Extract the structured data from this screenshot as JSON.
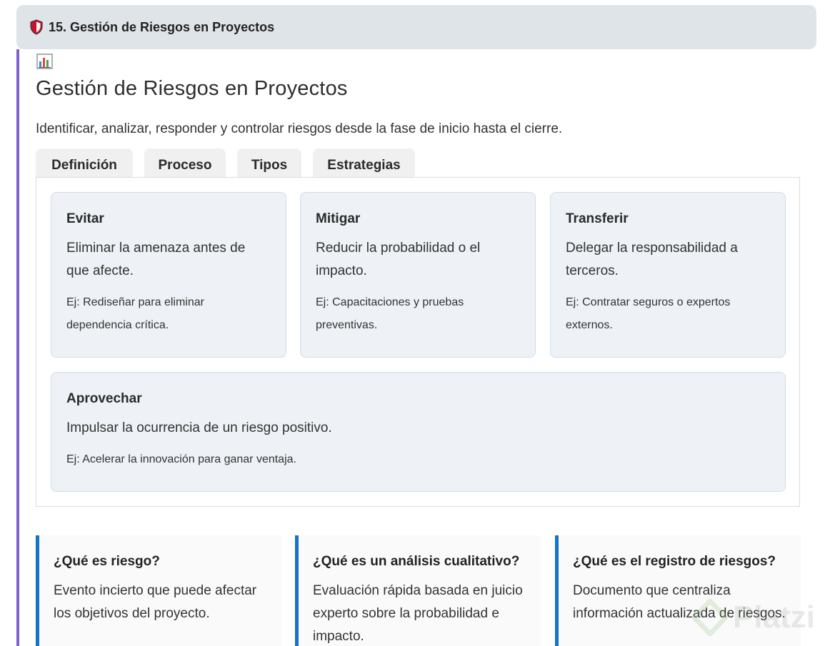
{
  "section": {
    "icon": "shield-icon",
    "title": "15. Gestión de Riesgos en Proyectos"
  },
  "content": {
    "icon": "bar-chart-icon",
    "title": "Gestión de Riesgos en Proyectos",
    "subtitle": "Identificar, analizar, responder y controlar riesgos desde la fase de inicio hasta el cierre."
  },
  "tabs": [
    {
      "label": "Definición"
    },
    {
      "label": "Proceso"
    },
    {
      "label": "Tipos"
    },
    {
      "label": "Estrategias"
    }
  ],
  "strategies": [
    {
      "title": "Evitar",
      "description": "Eliminar la amenaza antes de que afecte.",
      "example": "Ej: Rediseñar para eliminar dependencia crítica."
    },
    {
      "title": "Mitigar",
      "description": "Reducir la probabilidad o el impacto.",
      "example": "Ej: Capacitaciones y pruebas preventivas."
    },
    {
      "title": "Transferir",
      "description": "Delegar la responsabilidad a terceros.",
      "example": "Ej: Contratar seguros o expertos externos."
    },
    {
      "title": "Aprovechar",
      "description": "Impulsar la ocurrencia de un riesgo positivo.",
      "example": "Ej: Acelerar la innovación para ganar ventaja."
    }
  ],
  "faq": [
    {
      "question": "¿Qué es riesgo?",
      "answer": "Evento incierto que puede afectar los objetivos del proyecto."
    },
    {
      "question": "¿Qué es un análisis cualitativo?",
      "answer": "Evaluación rápida basada en juicio experto sobre la probabilidad e impacto."
    },
    {
      "question": "¿Qué es el registro de riesgos?",
      "answer": "Documento que centraliza información actualizada de riesgos."
    }
  ],
  "watermark": {
    "text": "Platzi"
  },
  "colors": {
    "accent_bar": "#7b61d1",
    "faq_border": "#1574c4",
    "card_background": "#eef2f6",
    "header_background": "#dfe4e8"
  }
}
